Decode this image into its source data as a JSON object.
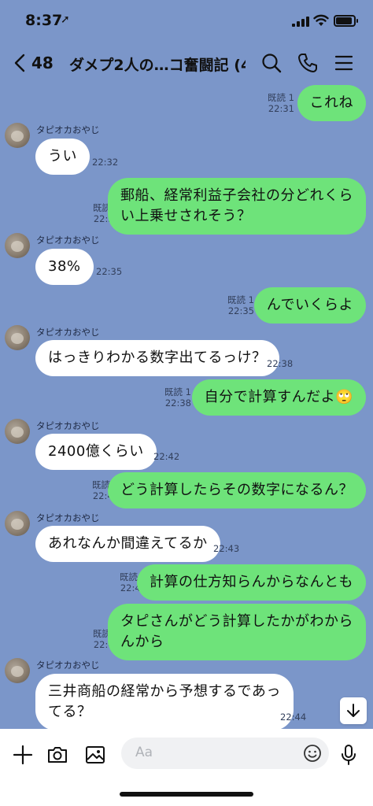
{
  "status": {
    "time": "8:37"
  },
  "header": {
    "back_count": "48",
    "title": "ダメプ2人の…コ奮闘記 (4)"
  },
  "messages": [
    {
      "dir": "out",
      "text": "これね",
      "read": "既読 1",
      "time": "22:31"
    },
    {
      "dir": "in",
      "sender": "タピオカおやじ",
      "text": "うい",
      "time": "22:32"
    },
    {
      "dir": "out",
      "lines": [
        "郵船、経常利益子会社の分どれくら",
        "い上乗せされそう？"
      ],
      "read": "既読 1",
      "time": "22:32"
    },
    {
      "dir": "in",
      "sender": "タピオカおやじ",
      "text": "38%",
      "time": "22:35"
    },
    {
      "dir": "out",
      "text": "んでいくらよ",
      "read": "既読 1",
      "time": "22:35"
    },
    {
      "dir": "in",
      "sender": "タピオカおやじ",
      "text": "はっきりわかる数字出てるっけ？",
      "time": "22:38"
    },
    {
      "dir": "out",
      "text": "自分で計算すんだよ",
      "emoji": "🙄",
      "read": "既読 1",
      "time": "22:38"
    },
    {
      "dir": "in",
      "sender": "タピオカおやじ",
      "text": "2400億くらい",
      "time": "22:42"
    },
    {
      "dir": "out",
      "text": "どう計算したらその数字になるん？",
      "read": "既読 1",
      "time": "22:42"
    },
    {
      "dir": "in",
      "sender": "タピオカおやじ",
      "text": "あれなんか間違えてるか",
      "time": "22:43"
    },
    {
      "dir": "out",
      "text": "計算の仕方知らんからなんとも",
      "read": "既読 1",
      "time": "22:44"
    },
    {
      "dir": "out",
      "lines": [
        "タピさんがどう計算したかがわから",
        "んから"
      ],
      "read": "既読 1",
      "time": "22:44"
    },
    {
      "dir": "in",
      "sender": "タピオカおやじ",
      "lines": [
        "三井商船の経常から予想するであっ",
        "てる？"
      ],
      "time": "22:44"
    }
  ],
  "input": {
    "placeholder": "Aa"
  },
  "icons": {
    "back": "chevron-left-icon",
    "search": "search-icon",
    "call": "phone-icon",
    "menu": "menu-icon",
    "add": "plus-icon",
    "camera": "camera-icon",
    "image": "image-icon",
    "emoji": "smiley-icon",
    "mic": "microphone-icon",
    "scroll": "arrow-down-icon"
  },
  "colors": {
    "chat_background": "#7b96c9",
    "outgoing_bubble": "#6ee37a",
    "incoming_bubble": "#ffffff"
  }
}
